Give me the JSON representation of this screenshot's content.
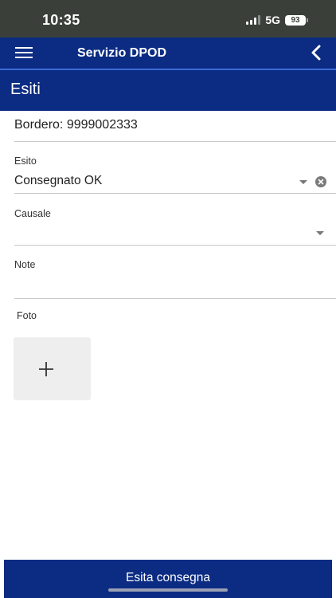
{
  "status_bar": {
    "time": "10:35",
    "network": "5G",
    "battery": "93"
  },
  "app_bar": {
    "title": "Servizio DPOD",
    "accent_color": "#0c2c83"
  },
  "section": {
    "title": "Esiti"
  },
  "form": {
    "bordero": "Bordero: 9999002333",
    "esito": {
      "label": "Esito",
      "value": "Consegnato OK"
    },
    "causale": {
      "label": "Causale",
      "value": ""
    },
    "note": {
      "label": "Note",
      "value": ""
    },
    "foto": {
      "label": "Foto",
      "add_symbol": "+"
    }
  },
  "footer": {
    "button_label": "Esita consegna"
  },
  "icons": [
    "menu-icon",
    "back-chevron-icon",
    "dropdown-arrow-icon",
    "clear-icon",
    "add-photo-icon"
  ]
}
